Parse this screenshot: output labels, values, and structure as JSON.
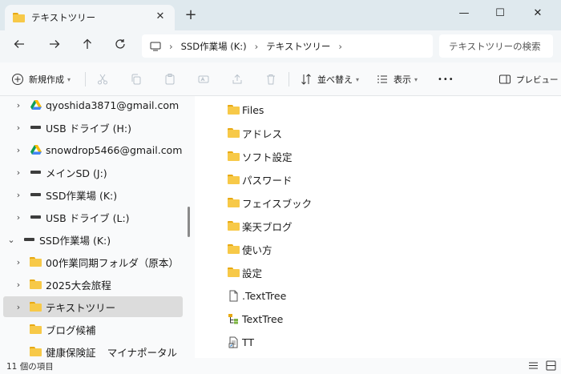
{
  "window": {
    "tab_title": "テキストツリー",
    "tab_close": "✕",
    "new_tab": "+",
    "minimize": "—",
    "maximize": "☐",
    "close": "✕"
  },
  "address": {
    "segments": [
      "SSD作業場 (K:)",
      "テキストツリー"
    ],
    "search_placeholder": "テキストツリーの検索"
  },
  "toolbar": {
    "new_label": "新規作成",
    "sort_label": "並べ替え",
    "view_label": "表示",
    "more_label": "•••",
    "preview_label": "プレビュー"
  },
  "nav_tree": [
    {
      "label": "qyoshida3871@gmail.com",
      "icon": "google-drive-icon",
      "expanded": false
    },
    {
      "label": "USB ドライブ (H:)",
      "icon": "drive-icon",
      "expanded": false
    },
    {
      "label": "snowdrop5466@gmail.com",
      "icon": "google-drive-icon",
      "expanded": false
    },
    {
      "label": "メインSD (J:)",
      "icon": "drive-icon",
      "expanded": false
    },
    {
      "label": "SSD作業場 (K:)",
      "icon": "drive-icon",
      "expanded": false
    },
    {
      "label": "USB ドライブ (L:)",
      "icon": "drive-icon",
      "expanded": false
    },
    {
      "label": "SSD作業場 (K:)",
      "icon": "drive-icon",
      "expanded": true
    },
    {
      "label": "00作業同期フォルダ（原本）",
      "icon": "folder-icon",
      "expanded": false
    },
    {
      "label": "2025大会旅程",
      "icon": "folder-icon",
      "expanded": false
    },
    {
      "label": "テキストツリー",
      "icon": "folder-icon",
      "expanded": false,
      "selected": true
    },
    {
      "label": "ブログ候補",
      "icon": "folder-icon"
    },
    {
      "label": "健康保険証 _ マイナポータル",
      "icon": "folder-icon"
    }
  ],
  "files": [
    {
      "name": "Files",
      "icon": "folder-icon"
    },
    {
      "name": "アドレス",
      "icon": "folder-icon"
    },
    {
      "name": "ソフト設定",
      "icon": "folder-icon"
    },
    {
      "name": "パスワード",
      "icon": "folder-icon"
    },
    {
      "name": "フェイスブック",
      "icon": "folder-icon"
    },
    {
      "name": "楽天ブログ",
      "icon": "folder-icon"
    },
    {
      "name": "使い方",
      "icon": "folder-icon"
    },
    {
      "name": "設定",
      "icon": "folder-icon"
    },
    {
      "name": ".TextTree",
      "icon": "file-icon"
    },
    {
      "name": "TextTree",
      "icon": "texttree-app-icon"
    },
    {
      "name": "TT",
      "icon": "shortcut-file-icon"
    }
  ],
  "status": {
    "item_count": "11 個の項目"
  },
  "colors": {
    "folder": "#f7c948",
    "accent": "#0067c0",
    "selected_row": "#dcdcdc"
  }
}
